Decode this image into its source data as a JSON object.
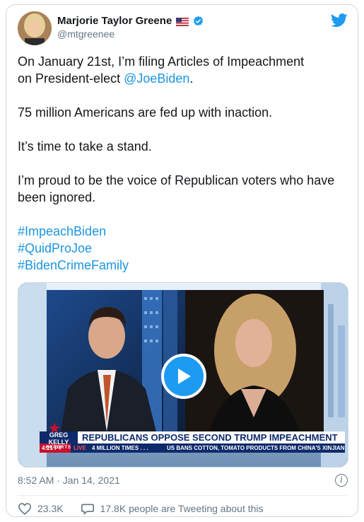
{
  "author": {
    "name": "Marjorie Taylor Greene",
    "handle": "@mtgreenee"
  },
  "tweet": {
    "line1a": "On January 21st, I’m filing Articles of Impeachment",
    "line1b": "on President-elect ",
    "mention": "@JoeBiden",
    "line1c": ".",
    "line2": "75 million Americans are fed up with inaction.",
    "line3": "It’s time to take a stand.",
    "line4": "I’m proud to be the voice of Republican voters who have been ignored.",
    "hashtags": [
      "#ImpeachBiden",
      "#QuidProJoe",
      "#BidenCrimeFamily"
    ]
  },
  "video": {
    "show_logo_top": "GREG KELLY",
    "show_logo_bottom": "REPORTS",
    "headline": "REPUBLICANS OPPOSE SECOND TRUMP IMPEACHMENT",
    "time": "4:21 PT",
    "live": "LIVE",
    "ticker1": "4 MILLION TIMES . . .",
    "ticker2": "US BANS COTTON, TOMATO PRODUCTS FROM CHINA'S XINJIAN"
  },
  "meta": {
    "timestamp": "8:52 AM · Jan 14, 2021"
  },
  "actions": {
    "likes": "23.3K",
    "people_tweeting": "17.8K people are Tweeting about this"
  },
  "colors": {
    "link": "#1b95e0",
    "twitter_blue": "#1d9bf0",
    "news_red": "#c8102e",
    "news_navy": "#0d2a6b"
  },
  "icons": [
    "verified-icon",
    "twitter-bird-icon",
    "play-icon",
    "info-icon",
    "heart-icon",
    "speech-bubble-icon",
    "us-flag-icon"
  ]
}
